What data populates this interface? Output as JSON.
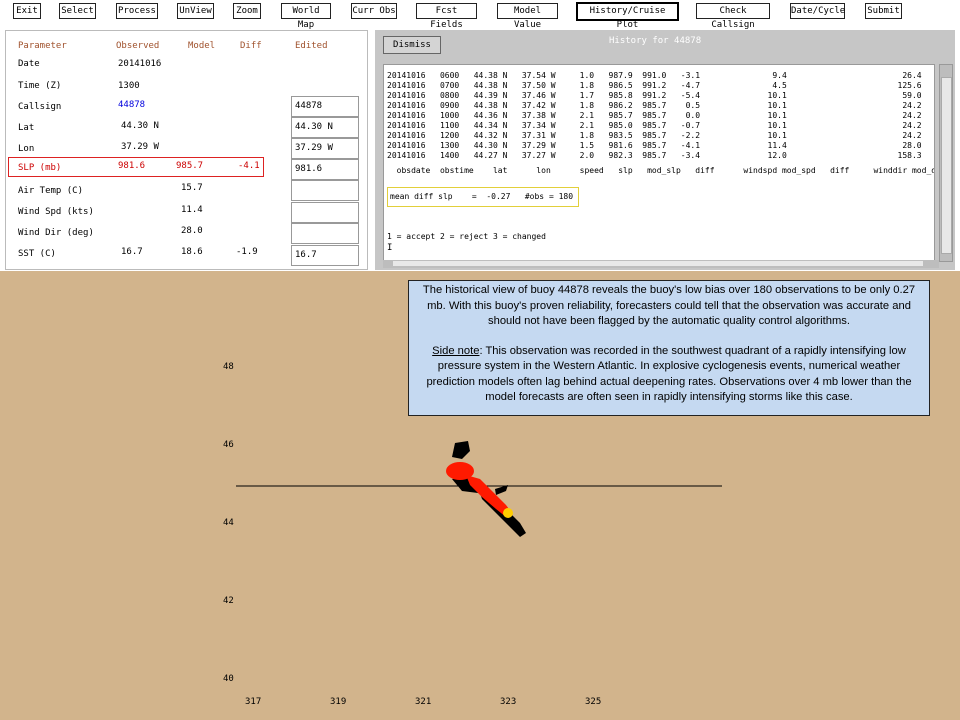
{
  "toolbar": {
    "exit": "Exit",
    "select": "Select",
    "process": "Process",
    "unview": "UnView",
    "zoom": "Zoom",
    "world_map": "World Map",
    "curr_obs": "Curr Obs",
    "fcst_fields": "Fcst Fields",
    "model_value": "Model Value",
    "history_cruise_plot": "History/Cruise Plot",
    "check_callsign": "Check Callsign",
    "date_cycle": "Date/Cycle",
    "submit": "Submit"
  },
  "table": {
    "headers": {
      "parameter": "Parameter",
      "observed": "Observed",
      "model": "Model",
      "diff": "Diff",
      "edited": "Edited"
    },
    "rows": [
      {
        "param": "Date",
        "obs": "20141016",
        "model": "",
        "diff": "",
        "edited": ""
      },
      {
        "param": "Time (Z)",
        "obs": "1300",
        "model": "",
        "diff": "",
        "edited": ""
      },
      {
        "param": "Callsign",
        "obs": "44878",
        "model": "",
        "diff": "",
        "edited": "44878"
      },
      {
        "param": "Lat",
        "obs": "44.30 N",
        "model": "",
        "diff": "",
        "edited": "44.30 N"
      },
      {
        "param": "Lon",
        "obs": "37.29 W",
        "model": "",
        "diff": "",
        "edited": "37.29 W"
      },
      {
        "param": "SLP (mb)",
        "obs": "981.6",
        "model": "985.7",
        "diff": "-4.1",
        "edited": "981.6"
      },
      {
        "param": "Air Temp (C)",
        "obs": "",
        "model": "15.7",
        "diff": "",
        "edited": ""
      },
      {
        "param": "Wind Spd (kts)",
        "obs": "",
        "model": "11.4",
        "diff": "",
        "edited": ""
      },
      {
        "param": "Wind Dir (deg)",
        "obs": "",
        "model": "28.0",
        "diff": "",
        "edited": ""
      },
      {
        "param": "SST (C)",
        "obs": "16.7",
        "model": "18.6",
        "diff": "-1.9",
        "edited": "16.7"
      }
    ]
  },
  "history": {
    "dismiss": "Dismiss",
    "title": "History for 44878",
    "rows": [
      "20141016   0600   44.38 N   37.54 W     1.0   987.9  991.0   -3.1               9.4                        26.4",
      "20141016   0700   44.38 N   37.50 W     1.8   986.5  991.2   -4.7               4.5                       125.6",
      "20141016   0800   44.39 N   37.46 W     1.7   985.8  991.2   -5.4              10.1                        59.0",
      "20141016   0900   44.38 N   37.42 W     1.8   986.2  985.7    0.5              10.1                        24.2",
      "20141016   1000   44.36 N   37.38 W     2.1   985.7  985.7    0.0              10.1                        24.2",
      "20141016   1100   44.34 N   37.34 W     2.1   985.0  985.7   -0.7              10.1                        24.2",
      "20141016   1200   44.32 N   37.31 W     1.8   983.5  985.7   -2.2              10.1                        24.2",
      "20141016   1300   44.30 N   37.29 W     1.5   981.6  985.7   -4.1              11.4                        28.0",
      "20141016   1400   44.27 N   37.27 W     2.0   982.3  985.7   -3.4              12.0                       158.3"
    ],
    "column_header": "  obsdate  obstime    lat      lon      speed   slp   mod_slp   diff      windspd mod_spd   diff     winddir mod_dir   di",
    "mean": "mean diff slp    =  -0.27   #obs = 180",
    "legend": "1 = accept 2 = reject 3 = changed"
  },
  "plot": {
    "y_labels": [
      "48",
      "46",
      "44",
      "42",
      "40"
    ],
    "x_labels": [
      "317",
      "319",
      "321",
      "323",
      "325"
    ],
    "colors": {
      "background": "#d2b48c",
      "track": "#000000",
      "highlight": "#ff1a00"
    }
  },
  "note": {
    "p1": "The historical view of buoy 44878 reveals the buoy's low bias over 180 observations  to be only 0.27 mb.  With this buoy's proven reliability, forecasters could tell that the observation was accurate and should not have been flagged by the automatic quality control algorithms.",
    "side_label": "Side note",
    "p2": ": This observation was recorded in the southwest quadrant of a rapidly intensifying low pressure system  in the Western Atlantic.  In explosive cyclogenesis events, numerical weather prediction models often lag behind actual deepening rates. Observations  over 4 mb lower than the model forecasts  are often seen  in rapidly intensifying storms like this case."
  }
}
